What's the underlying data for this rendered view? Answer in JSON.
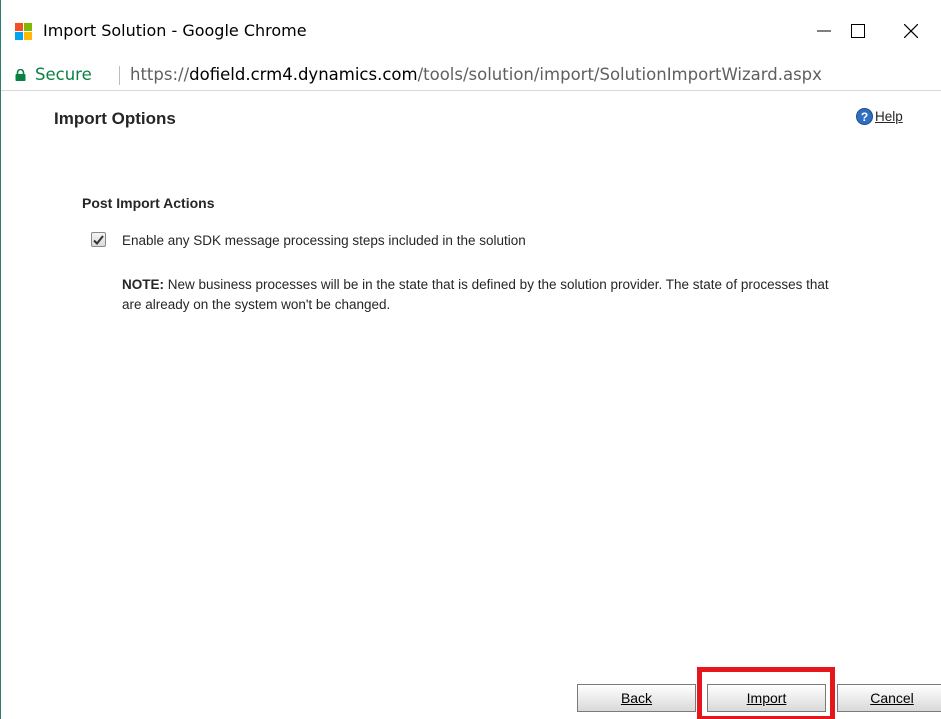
{
  "window": {
    "title": "Import Solution - Google Chrome",
    "controls": {
      "minimize": "—",
      "maximize": "☐",
      "close": "✕"
    }
  },
  "addressbar": {
    "security_label": "Secure",
    "url_scheme": "https://",
    "url_host": "dofield.crm4.dynamics.com",
    "url_path": "/tools/solution/import/SolutionImportWizard.aspx"
  },
  "page": {
    "title": "Import Options",
    "help": {
      "icon_glyph": "?",
      "label": "Help"
    }
  },
  "post_import": {
    "section_title": "Post Import Actions",
    "checkbox_label": "Enable any SDK message processing steps included in the solution",
    "checkbox_checked": true,
    "note_prefix": "NOTE:",
    "note_text": " New business processes will be in the state that is defined by the solution provider. The state of processes that are already on the system won't be changed."
  },
  "footer": {
    "back_label": "Back",
    "import_label": "Import",
    "cancel_label": "Cancel"
  },
  "colors": {
    "highlight": "#e5161c",
    "secure_green": "#0a8043",
    "help_blue": "#2e6fbf"
  }
}
